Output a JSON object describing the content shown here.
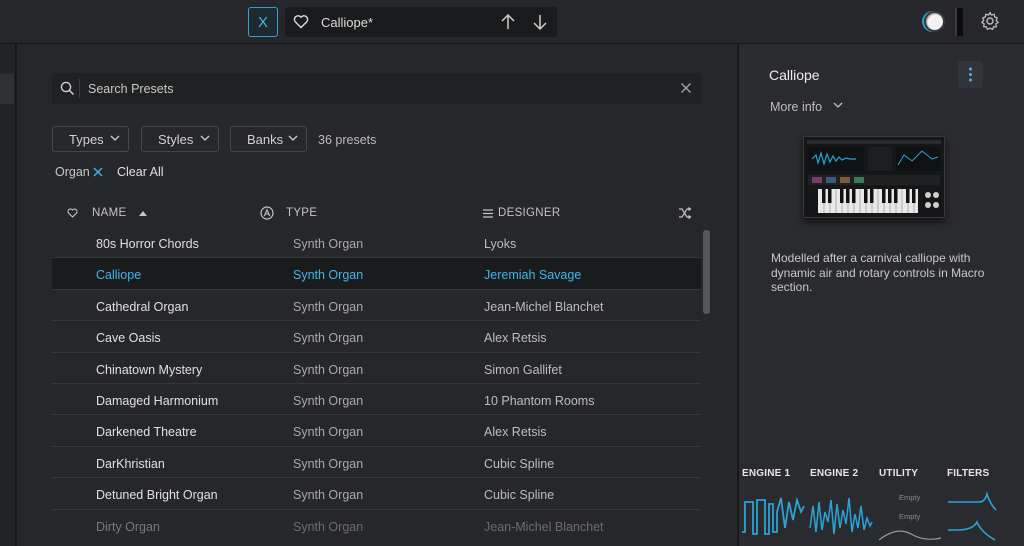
{
  "topbar": {
    "close_label": "X",
    "preset_name": "Calliope*"
  },
  "search": {
    "placeholder": "Search Presets"
  },
  "filters": {
    "types_label": "Types",
    "styles_label": "Styles",
    "banks_label": "Banks",
    "preset_count": "36 presets",
    "active_tag": "Organ",
    "clear_all_label": "Clear All"
  },
  "table": {
    "headers": {
      "name": "NAME",
      "type": "TYPE",
      "designer": "DESIGNER"
    },
    "rows": [
      {
        "name": "80s Horror Chords",
        "type": "Synth Organ",
        "designer": "Lyoks"
      },
      {
        "name": "Calliope",
        "type": "Synth Organ",
        "designer": "Jeremiah Savage"
      },
      {
        "name": "Cathedral Organ",
        "type": "Synth Organ",
        "designer": "Jean-Michel Blanchet"
      },
      {
        "name": "Cave Oasis",
        "type": "Synth Organ",
        "designer": "Alex Retsis"
      },
      {
        "name": "Chinatown Mystery",
        "type": "Synth Organ",
        "designer": "Simon Gallifet"
      },
      {
        "name": "Damaged Harmonium",
        "type": "Synth Organ",
        "designer": "10 Phantom Rooms"
      },
      {
        "name": "Darkened Theatre",
        "type": "Synth Organ",
        "designer": "Alex Retsis"
      },
      {
        "name": "DarKhristian",
        "type": "Synth Organ",
        "designer": "Cubic Spline"
      },
      {
        "name": "Detuned Bright Organ",
        "type": "Synth Organ",
        "designer": "Cubic Spline"
      },
      {
        "name": "Dirty Organ",
        "type": "Synth Organ",
        "designer": "Jean-Michel Blanchet"
      }
    ]
  },
  "info_panel": {
    "title": "Calliope",
    "more_info_label": "More info",
    "description": "Modelled after a carnival calliope with dynamic air and rotary controls in Macro section."
  },
  "engines": {
    "engine1": "ENGINE 1",
    "engine2": "ENGINE 2",
    "utility": "UTILITY",
    "filters": "FILTERS",
    "utility_slot1": "Empty",
    "utility_slot2": "Empty"
  },
  "colors": {
    "accent": "#3fb6e8",
    "background": "#26272a",
    "selected_row": "#1a1b1d"
  }
}
